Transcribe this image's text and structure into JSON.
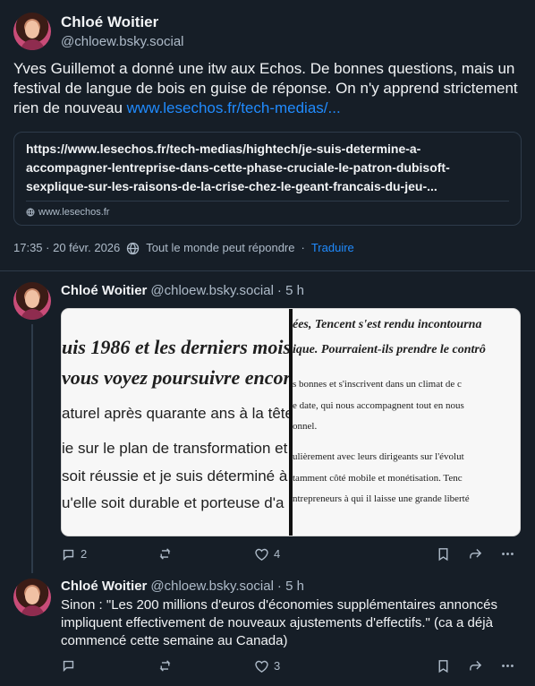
{
  "post": {
    "author_name": "Chloé Woitier",
    "author_handle": "@chloew.bsky.social",
    "text_prefix": "Yves Guillemot a donné une itw aux Echos. De bonnes questions, mais un festival de langue de bois en guise de réponse. On n'y apprend strictement rien de nouveau ",
    "text_link": "www.lesechos.fr/tech-medias/...",
    "card": {
      "title": "https://www.lesechos.fr/tech-medias/hightech/je-suis-determine-a-accompagner-lentreprise-dans-cette-phase-cruciale-le-patron-dubisoft-sexplique-sur-les-raisons-de-la-crise-chez-le-geant-francais-du-jeu-...",
      "domain": "www.lesechos.fr"
    },
    "timestamp": "17:35 · 20 févr. 2026",
    "reply_permission": "Tout le monde peut répondre",
    "separator": "·",
    "translate": "Traduire"
  },
  "replies": [
    {
      "author_name": "Chloé Woitier",
      "author_handle": "@chloew.bsky.social",
      "time": "· 5 h",
      "image": {
        "left_lines": [
          "uis 1986 et les derniers mois",
          "vous voyez poursuivre encor",
          "aturel après quarante ans à la tête",
          "ie sur le plan de transformation et",
          "soit réussie et je suis déterminé à",
          "u'elle soit durable et porteuse d'a"
        ],
        "right_lines": [
          "ées, Tencent s'est rendu incontourna",
          "ique. Pourraient-ils prendre le contrô",
          "s bonnes et s'inscrivent dans un climat de c",
          "e date, qui nous accompagnent tout en nous",
          "onnel.",
          "ulièrement avec leurs dirigeants sur l'évolut",
          "tamment côté mobile et monétisation. Tenc",
          "ntrepreneurs à qui il laisse une grande liberté"
        ]
      },
      "stats": {
        "replies": "2",
        "reposts": "",
        "likes": "4"
      }
    },
    {
      "author_name": "Chloé Woitier",
      "author_handle": "@chloew.bsky.social",
      "time": "· 5 h",
      "text": "Sinon : \"Les 200 millions d'euros d'économies supplémentaires annoncés impliquent effectivement de nouveaux ajustements d'effectifs.\" (ca a déjà commencé cette semaine au Canada)",
      "stats": {
        "replies": "",
        "reposts": "",
        "likes": "3"
      }
    }
  ],
  "icons": {
    "reply": "speech-bubble-icon",
    "repost": "repost-icon",
    "like": "heart-icon",
    "bookmark": "bookmark-icon",
    "share": "share-icon",
    "more": "more-icon",
    "globe": "globe-icon"
  },
  "colors": {
    "background": "#161e27",
    "text": "#f1f3f5",
    "muted": "#aebbc9",
    "link": "#208bfe",
    "border": "#2e3b4a"
  }
}
